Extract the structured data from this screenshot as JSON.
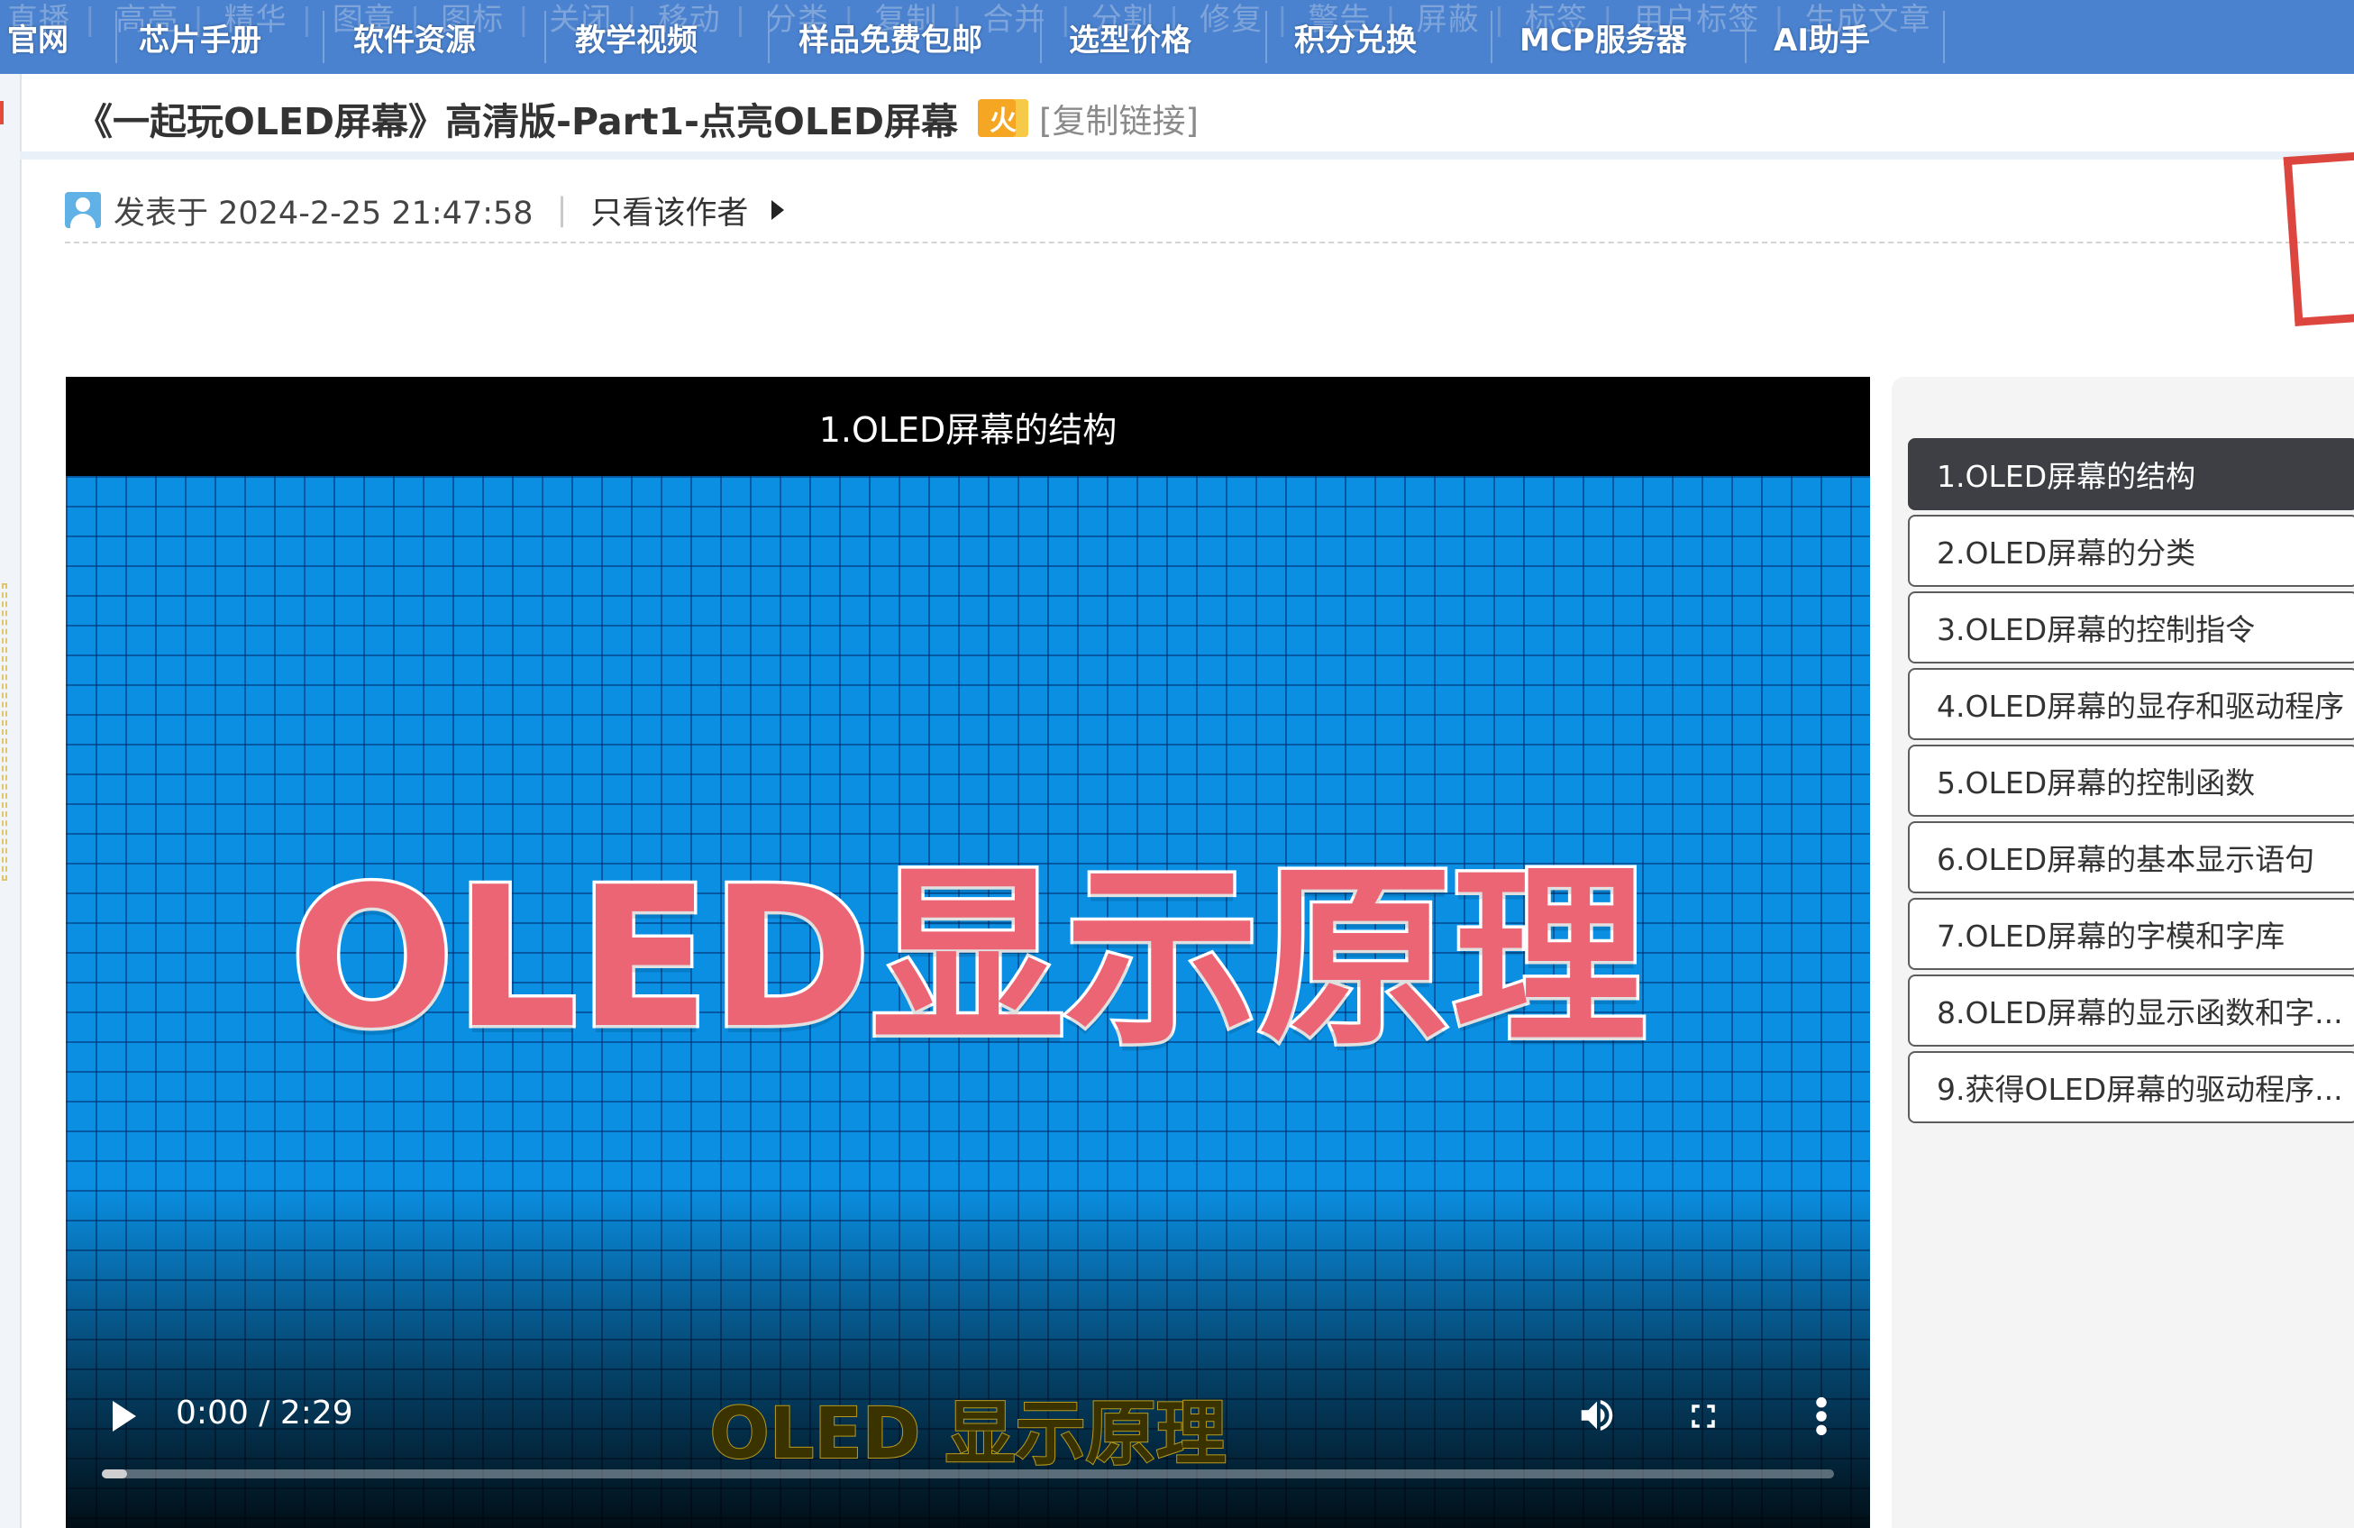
{
  "nav": {
    "items": [
      "官网",
      "芯片手册",
      "软件资源",
      "教学视频",
      "样品免费包邮",
      "选型价格",
      "积分兑换",
      "MCP服务器",
      "AI助手"
    ],
    "ghost_items": [
      "直播",
      "高亮",
      "精华",
      "图章",
      "图标",
      "关闭",
      "移动",
      "分类",
      "复制",
      "合并",
      "分割",
      "修复",
      "警告",
      "屏蔽",
      "标签",
      "用户标签",
      "生成文章"
    ]
  },
  "post": {
    "title": "《一起玩OLED屏幕》高清版-Part1-点亮OLED屏幕",
    "hot_badge": "火",
    "copy_link": "[复制链接]",
    "posted_label": "发表于 2024-2-25 21:47:58",
    "separator": "|",
    "author_only": "只看该作者"
  },
  "video": {
    "title": "1.OLED屏幕的结构",
    "frame_text": "OLED显示原理",
    "subtitle": "OLED 显示原理",
    "time": "0:00 / 2:29",
    "progress": 0.0
  },
  "playlist": {
    "items": [
      {
        "label": "1.OLED屏幕的结构",
        "active": true
      },
      {
        "label": "2.OLED屏幕的分类",
        "active": false
      },
      {
        "label": "3.OLED屏幕的控制指令",
        "active": false
      },
      {
        "label": "4.OLED屏幕的显存和驱动程序",
        "active": false
      },
      {
        "label": "5.OLED屏幕的控制函数",
        "active": false
      },
      {
        "label": "6.OLED屏幕的基本显示语句",
        "active": false
      },
      {
        "label": "7.OLED屏幕的字模和字库",
        "active": false
      },
      {
        "label": "8.OLED屏幕的显示函数和字...",
        "active": false
      },
      {
        "label": "9.获得OLED屏幕的驱动程序...",
        "active": false
      }
    ]
  },
  "colors": {
    "nav_bg": "#4a82cf",
    "video_bg": "#0a8fe3",
    "frame_text": "#ec6574",
    "active_item_bg": "#3d3f45",
    "hot_badge": "#f5a623"
  }
}
